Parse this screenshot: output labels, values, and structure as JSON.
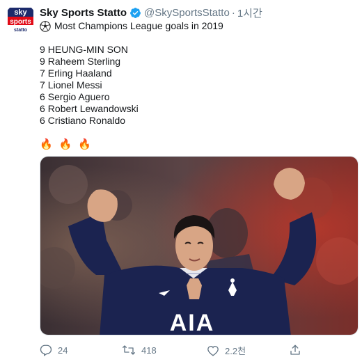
{
  "tweet": {
    "display_name": "Sky Sports Statto",
    "handle": "@SkySportsStatto",
    "separator": "·",
    "time": "1시간",
    "title": "Most Champions League goals in 2019",
    "ranking": [
      {
        "goals": "9",
        "player": "HEUNG-MIN SON"
      },
      {
        "goals": "9",
        "player": "Raheem Sterling"
      },
      {
        "goals": "7",
        "player": "Erling Haaland"
      },
      {
        "goals": "7",
        "player": "Lionel Messi"
      },
      {
        "goals": "6",
        "player": "Sergio Aguero"
      },
      {
        "goals": "6",
        "player": "Robert Lewandowski"
      },
      {
        "goals": "6",
        "player": "Cristiano Ronaldo"
      }
    ],
    "fires": [
      "🔥",
      "🔥",
      "🔥"
    ]
  },
  "avatar": {
    "line1": "sky",
    "line2": "sports",
    "line3": "statto"
  },
  "media": {
    "shirt_sponsor": "AIA"
  },
  "actions": {
    "reply_count": "24",
    "retweet_count": "418",
    "like_count": "2.2천"
  },
  "colors": {
    "verified": "#1da1f2",
    "muted": "#657786",
    "kit_navy": "#1b2350",
    "sky_red": "#e10b17"
  },
  "icons": {
    "verified": "verified-badge-icon",
    "ball": "soccer-ball-icon",
    "reply": "reply-icon",
    "retweet": "retweet-icon",
    "like": "heart-icon",
    "share": "share-icon"
  }
}
